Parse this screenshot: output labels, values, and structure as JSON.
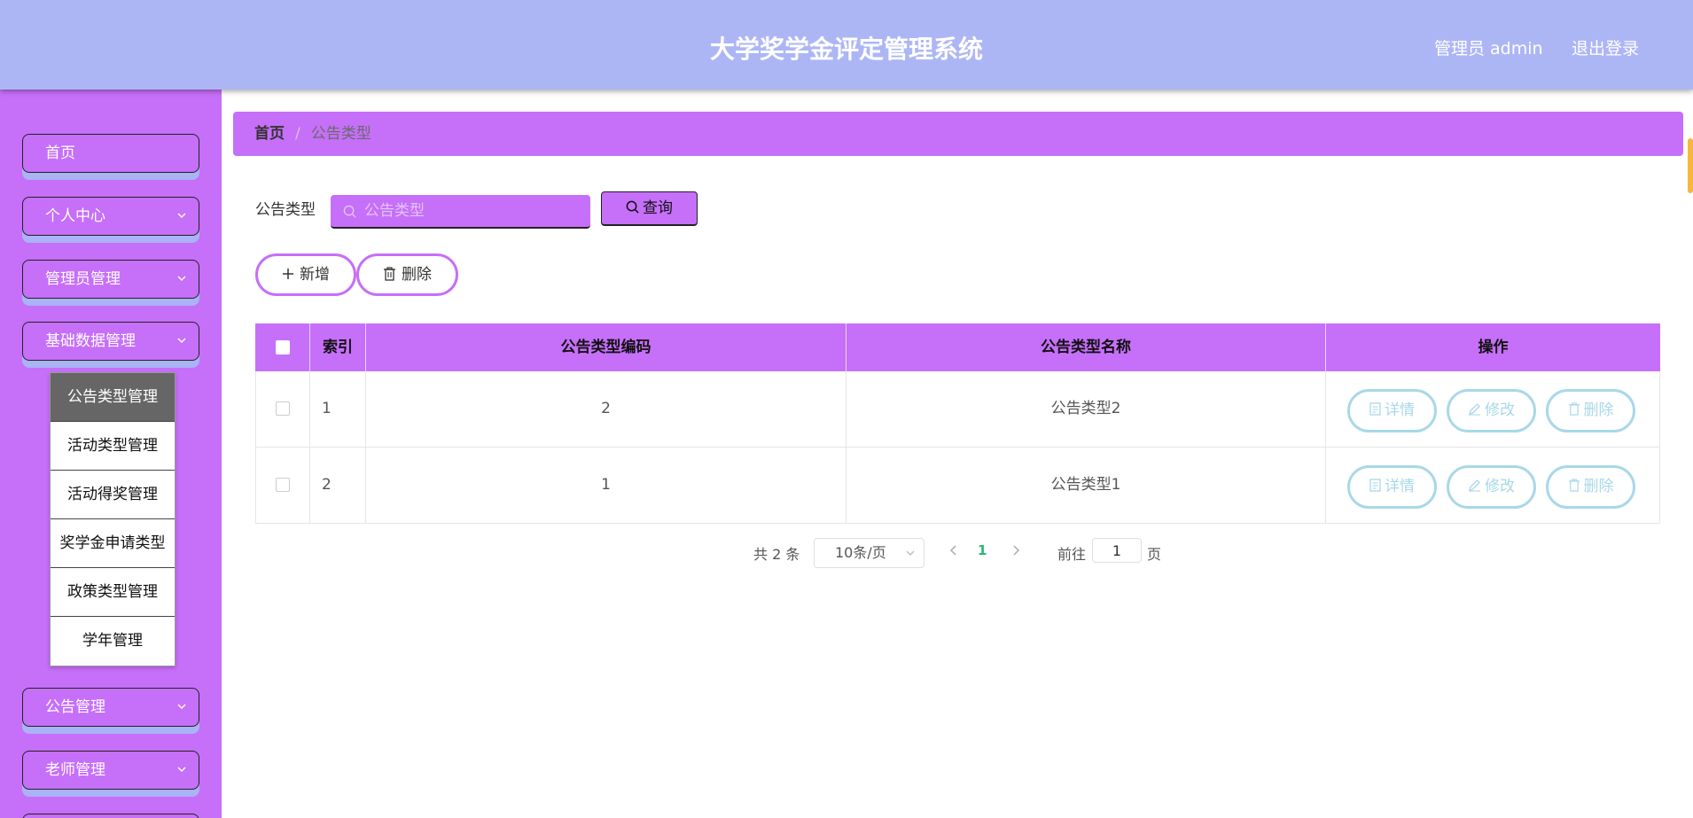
{
  "header": {
    "title": "大学奖学金评定管理系统",
    "admin_label": "管理员 admin",
    "logout": "退出登录"
  },
  "sidebar": {
    "items": [
      {
        "label": "首页"
      },
      {
        "label": "个人中心"
      },
      {
        "label": "管理员管理"
      },
      {
        "label": "基础数据管理"
      },
      {
        "label": "公告管理"
      },
      {
        "label": "老师管理"
      }
    ],
    "submenu": [
      {
        "label": "公告类型管理"
      },
      {
        "label": "活动类型管理"
      },
      {
        "label": "活动得奖管理"
      },
      {
        "label": "奖学金申请类型"
      },
      {
        "label": "政策类型管理"
      },
      {
        "label": "学年管理"
      }
    ]
  },
  "breadcrumb": {
    "home": "首页",
    "separator": "/",
    "current": "公告类型"
  },
  "search": {
    "label": "公告类型",
    "placeholder": "公告类型",
    "query_button": "查询"
  },
  "actions": {
    "add": "新增",
    "delete": "删除"
  },
  "table": {
    "columns": [
      "索引",
      "公告类型编码",
      "公告类型名称",
      "操作"
    ],
    "rows": [
      {
        "index": "1",
        "code": "2",
        "name": "公告类型2"
      },
      {
        "index": "2",
        "code": "1",
        "name": "公告类型1"
      }
    ],
    "row_actions": {
      "detail": "详情",
      "edit": "修改",
      "delete": "删除"
    }
  },
  "pagination": {
    "total": "共 2 条",
    "page_size": "10条/页",
    "current_page": "1",
    "goto_label": "前往",
    "goto_value": "1",
    "page_unit": "页"
  },
  "colors": {
    "header_bg": "#adb6f5",
    "sidebar_bg": "#c66ff9",
    "accent": "#c66ff9",
    "row_action_border": "#a8d8e8",
    "active_page": "#2bb673"
  }
}
